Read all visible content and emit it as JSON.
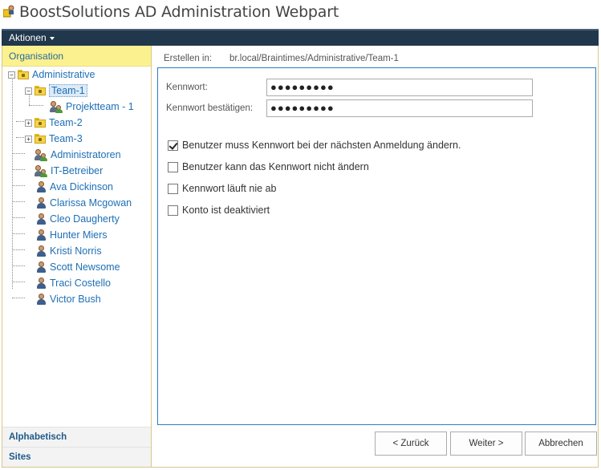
{
  "window": {
    "title": "BoostSolutions AD Administration Webpart"
  },
  "toolbar": {
    "actions_label": "Aktionen"
  },
  "left_panel": {
    "header": "Organisation",
    "tree": {
      "root": {
        "label": "Administrative",
        "toggle": "−"
      },
      "items": [
        {
          "label": "Team-1",
          "toggle": "−"
        },
        {
          "label": "Projektteam - 1"
        },
        {
          "label": "Team-2",
          "toggle": "+"
        },
        {
          "label": "Team-3",
          "toggle": "+"
        },
        {
          "label": "Administratoren"
        },
        {
          "label": "IT-Betreiber"
        },
        {
          "label": "Ava Dickinson"
        },
        {
          "label": "Clarissa Mcgowan"
        },
        {
          "label": "Cleo Daugherty"
        },
        {
          "label": "Hunter Miers"
        },
        {
          "label": "Kristi Norris"
        },
        {
          "label": "Scott Newsome"
        },
        {
          "label": "Traci Costello"
        },
        {
          "label": "Victor Bush"
        }
      ]
    },
    "alphabetic_link": "Alphabetisch",
    "sites_link": "Sites"
  },
  "form": {
    "create_in_label": "Erstellen in:",
    "create_in_value": "br.local/Braintimes/Administrative/Team-1",
    "password_label": "Kennwort:",
    "password_value": "●●●●●●●●●",
    "confirm_label": "Kennwort bestätigen:",
    "confirm_value": "●●●●●●●●●",
    "options": [
      {
        "label": "Benutzer muss Kennwort bei der nächsten Anmeldung ändern.",
        "checked": true
      },
      {
        "label": "Benutzer kann das Kennwort nicht ändern",
        "checked": false
      },
      {
        "label": "Kennwort läuft nie ab",
        "checked": false
      },
      {
        "label": "Konto ist deaktiviert",
        "checked": false
      }
    ]
  },
  "buttons": {
    "back": "< Zurück",
    "next": "Weiter >",
    "cancel": "Abbrechen"
  }
}
